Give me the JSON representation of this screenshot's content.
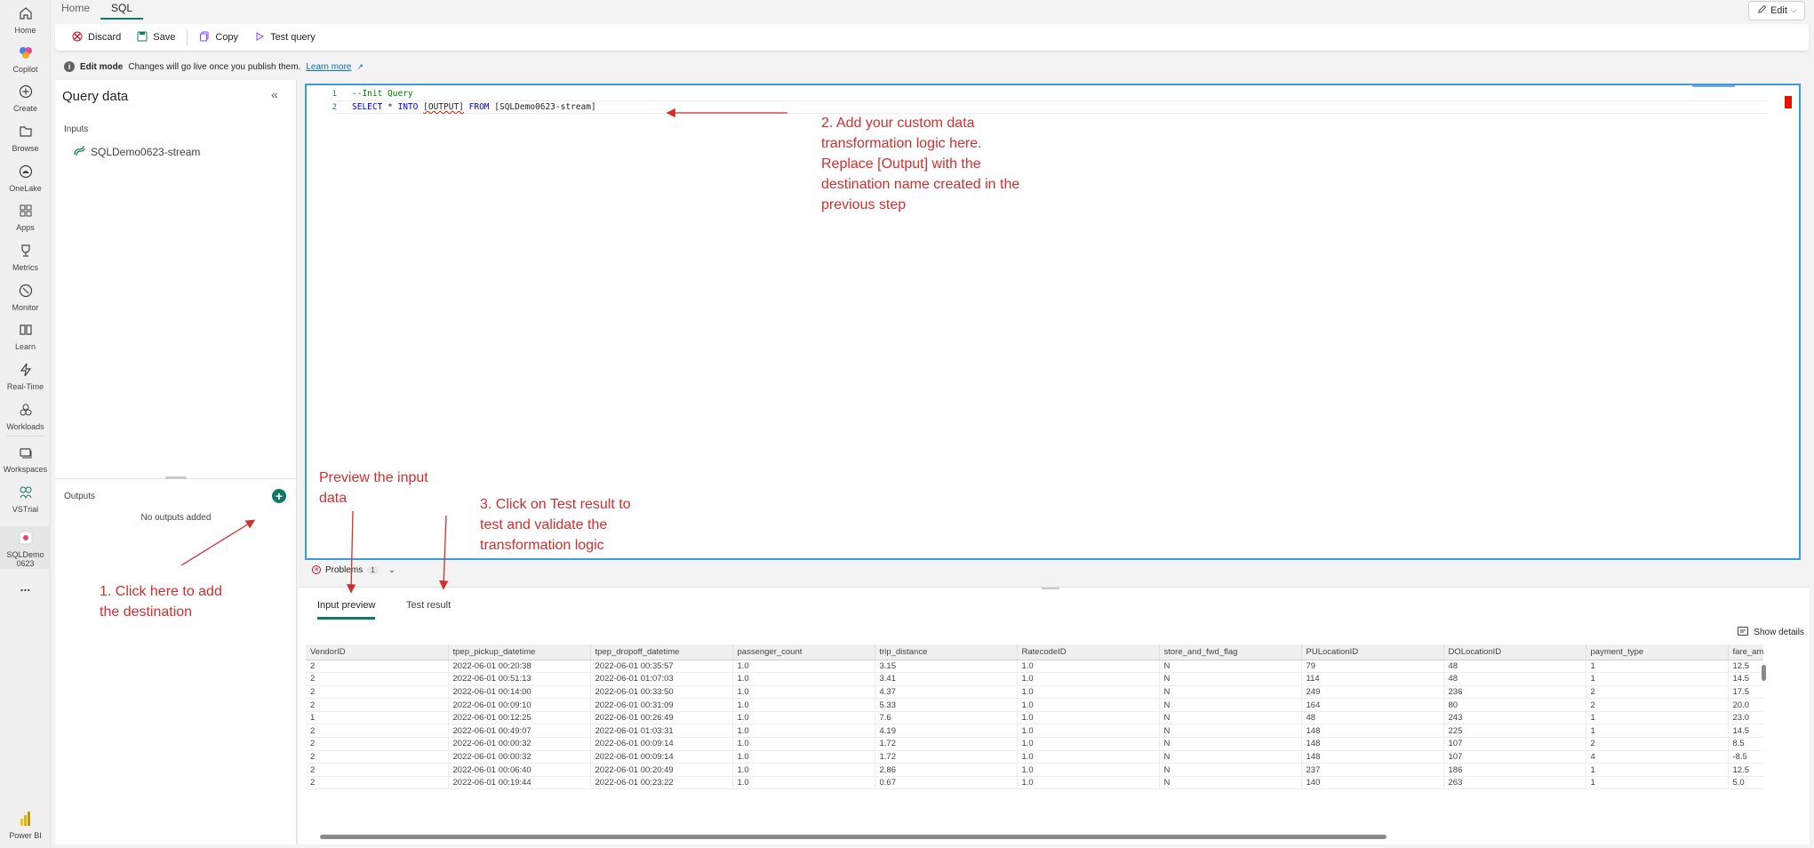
{
  "rail": {
    "items": [
      {
        "label": "Home",
        "icon": "home-icon"
      },
      {
        "label": "Copilot",
        "icon": "copilot-icon"
      },
      {
        "label": "Create",
        "icon": "create-icon"
      },
      {
        "label": "Browse",
        "icon": "browse-icon"
      },
      {
        "label": "OneLake",
        "icon": "onelake-icon"
      },
      {
        "label": "Apps",
        "icon": "apps-icon"
      },
      {
        "label": "Metrics",
        "icon": "metrics-icon"
      },
      {
        "label": "Monitor",
        "icon": "monitor-icon"
      },
      {
        "label": "Learn",
        "icon": "learn-icon"
      },
      {
        "label": "Real-Time",
        "icon": "real-time-icon"
      },
      {
        "label": "Workloads",
        "icon": "workloads-icon"
      },
      {
        "label": "Workspaces",
        "icon": "workspaces-icon"
      },
      {
        "label": "VSTrial",
        "icon": "vstrial-icon"
      },
      {
        "label": "SQLDemo0623",
        "icon": "eventstream-icon"
      }
    ],
    "more": "...",
    "powerbi": "Power BI"
  },
  "tabs": [
    "Home",
    "SQL"
  ],
  "edit_button": "Edit",
  "toolbar": {
    "discard": "Discard",
    "save": "Save",
    "copy": "Copy",
    "test_query": "Test query"
  },
  "edit_mode": {
    "title": "Edit mode",
    "message": "Changes will go live once you publish them.",
    "link": "Learn more"
  },
  "query_panel": {
    "title": "Query data",
    "inputs_label": "Inputs",
    "input_stream": "SQLDemo0623-stream",
    "outputs_label": "Outputs",
    "no_outputs": "No outputs added"
  },
  "editor": {
    "lines": [
      {
        "n": "1",
        "comment": "--Init Query"
      },
      {
        "n": "2",
        "kw1": "SELECT",
        "star": " * ",
        "kw2": "INTO",
        "out": "[OUTPUT]",
        "kw3": "FROM",
        "src": "[SQLDemo0623-stream]"
      }
    ]
  },
  "problems": {
    "label": "Problems",
    "count": "1"
  },
  "results": {
    "tabs": [
      "Input preview",
      "Test result"
    ],
    "show_details": "Show details",
    "columns": [
      "VendorID",
      "tpep_pickup_datetime",
      "tpep_dropoff_datetime",
      "passenger_count",
      "trip_distance",
      "RatecodeID",
      "store_and_fwd_flag",
      "PULocationID",
      "DOLocationID",
      "payment_type",
      "fare_amount"
    ],
    "rows": [
      [
        "2",
        "2022-06-01 00:20:38",
        "2022-06-01 00:35:57",
        "1.0",
        "3.15",
        "1.0",
        "N",
        "79",
        "48",
        "1",
        "12.5"
      ],
      [
        "2",
        "2022-06-01 00:51:13",
        "2022-06-01 01:07:03",
        "1.0",
        "3.41",
        "1.0",
        "N",
        "114",
        "48",
        "1",
        "14.5"
      ],
      [
        "2",
        "2022-06-01 00:14:00",
        "2022-06-01 00:33:50",
        "1.0",
        "4.37",
        "1.0",
        "N",
        "249",
        "236",
        "2",
        "17.5"
      ],
      [
        "2",
        "2022-06-01 00:09:10",
        "2022-06-01 00:31:09",
        "1.0",
        "5.33",
        "1.0",
        "N",
        "164",
        "80",
        "2",
        "20.0"
      ],
      [
        "1",
        "2022-06-01 00:12:25",
        "2022-06-01 00:26:49",
        "1.0",
        "7.6",
        "1.0",
        "N",
        "48",
        "243",
        "1",
        "23.0"
      ],
      [
        "2",
        "2022-06-01 00:49:07",
        "2022-06-01 01:03:31",
        "1.0",
        "4.19",
        "1.0",
        "N",
        "148",
        "225",
        "1",
        "14.5"
      ],
      [
        "2",
        "2022-06-01 00:00:32",
        "2022-06-01 00:09:14",
        "1.0",
        "1.72",
        "1.0",
        "N",
        "148",
        "107",
        "2",
        "8.5"
      ],
      [
        "2",
        "2022-06-01 00:00:32",
        "2022-06-01 00:09:14",
        "1.0",
        "1.72",
        "1.0",
        "N",
        "148",
        "107",
        "4",
        "-8.5"
      ],
      [
        "2",
        "2022-06-01 00:06:40",
        "2022-06-01 00:20:49",
        "1.0",
        "2.86",
        "1.0",
        "N",
        "237",
        "186",
        "1",
        "12.5"
      ],
      [
        "2",
        "2022-06-01 00:19:44",
        "2022-06-01 00:23:22",
        "1.0",
        "0.67",
        "1.0",
        "N",
        "140",
        "263",
        "1",
        "5.0"
      ]
    ]
  },
  "annotations": {
    "step1": [
      "1. Click here to add",
      "the destination"
    ],
    "step2": [
      "2. Add your custom data",
      "transformation logic here.",
      "Replace [Output] with the",
      "destination name created in the",
      "previous step"
    ],
    "step3": [
      "3. Click on Test result to",
      "test and validate the",
      "transformation logic"
    ],
    "preview": [
      "Preview the input",
      "data"
    ]
  },
  "colors": {
    "accent": "#117865",
    "annotation": "#d32f2f",
    "editor_border": "#3d9bd8"
  }
}
